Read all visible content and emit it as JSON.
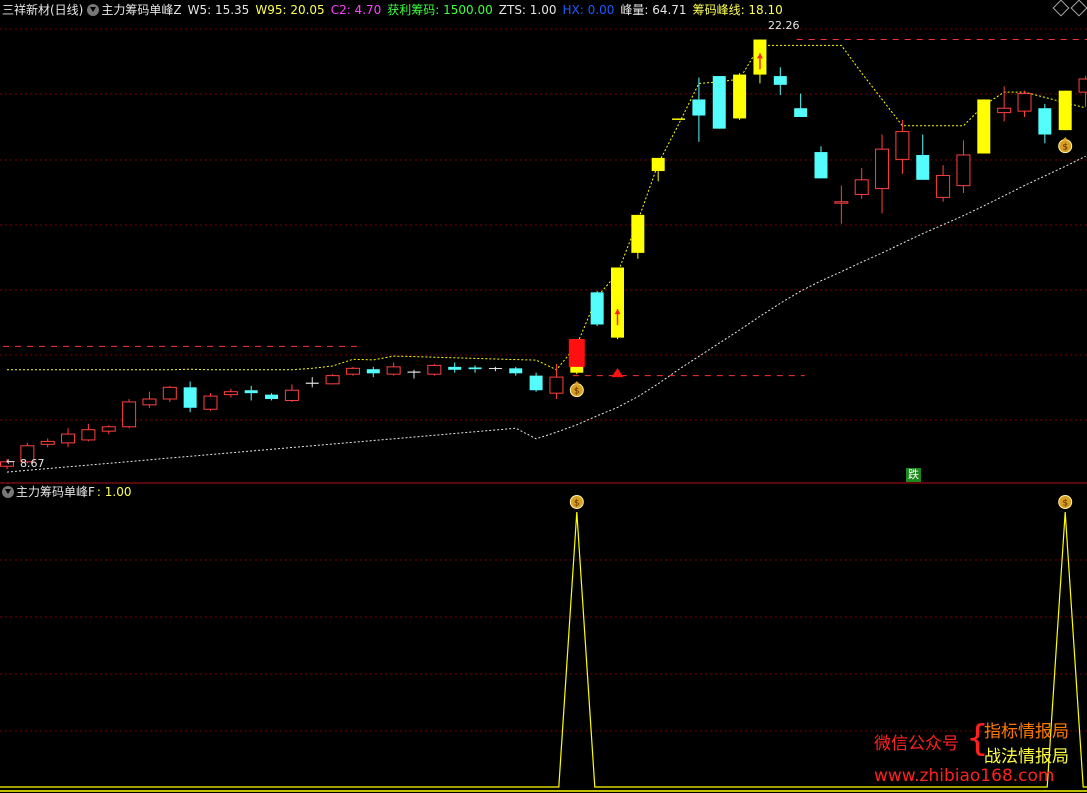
{
  "header": {
    "stock": "三祥新材(日线)",
    "indicator": "主力筹码单峰Z",
    "w5": "W5: 15.35",
    "w95": "W95: 20.05",
    "c2": "C2: 4.70",
    "profit": "获利筹码: 1500.00",
    "zts": "ZTS: 1.00",
    "hx": "HX: 0.00",
    "peak": "峰量: 64.71",
    "peakline": "筹码峰线: 18.10"
  },
  "sub_header": {
    "indicator": "主力筹码单峰F",
    "value": ": 1.00"
  },
  "labels": {
    "high_price": "22.26",
    "low_price": "8.67",
    "fall_tag": "跌",
    "money_glyph": "$"
  },
  "watermark": {
    "wechat": "微信公众号",
    "name1": "指标情报局",
    "name2": "战法情报局",
    "url": "www.zhibiao168.com"
  },
  "colors": {
    "bull": "#ff4040",
    "bear": "#54fcfc",
    "signal": "#ffff00",
    "grid": "#7a0000",
    "purple": "#ff40ff",
    "blue": "#1e5aff",
    "green": "#40ff40"
  },
  "chart_data": {
    "type": "candlestick",
    "candles": [
      {
        "o": 8.8,
        "c": 8.95,
        "h": 9.05,
        "l": 8.7,
        "t": "up"
      },
      {
        "o": 8.95,
        "c": 9.5,
        "h": 9.6,
        "l": 8.9,
        "t": "up"
      },
      {
        "o": 9.55,
        "c": 9.65,
        "h": 9.75,
        "l": 9.45,
        "t": "up"
      },
      {
        "o": 9.6,
        "c": 9.9,
        "h": 10.1,
        "l": 9.45,
        "t": "up"
      },
      {
        "o": 9.7,
        "c": 10.05,
        "h": 10.25,
        "l": 9.65,
        "t": "up"
      },
      {
        "o": 10.0,
        "c": 10.15,
        "h": 10.2,
        "l": 9.9,
        "t": "up"
      },
      {
        "o": 10.15,
        "c": 11.0,
        "h": 11.1,
        "l": 10.1,
        "t": "up"
      },
      {
        "o": 10.9,
        "c": 11.1,
        "h": 11.35,
        "l": 10.8,
        "t": "up"
      },
      {
        "o": 11.1,
        "c": 11.5,
        "h": 11.55,
        "l": 11.0,
        "t": "up"
      },
      {
        "o": 11.5,
        "c": 10.8,
        "h": 11.7,
        "l": 10.65,
        "t": "down"
      },
      {
        "o": 10.75,
        "c": 11.2,
        "h": 11.3,
        "l": 10.7,
        "t": "up"
      },
      {
        "o": 11.25,
        "c": 11.35,
        "h": 11.45,
        "l": 11.15,
        "t": "up"
      },
      {
        "o": 11.4,
        "c": 11.3,
        "h": 11.55,
        "l": 11.05,
        "t": "down"
      },
      {
        "o": 11.25,
        "c": 11.1,
        "h": 11.3,
        "l": 11.05,
        "t": "down"
      },
      {
        "o": 11.05,
        "c": 11.4,
        "h": 11.6,
        "l": 11.0,
        "t": "up"
      },
      {
        "o": 11.62,
        "c": 11.66,
        "h": 11.85,
        "l": 11.5,
        "t": "flat"
      },
      {
        "o": 11.62,
        "c": 11.9,
        "h": 11.95,
        "l": 11.6,
        "t": "up"
      },
      {
        "o": 11.95,
        "c": 12.15,
        "h": 12.2,
        "l": 11.9,
        "t": "up"
      },
      {
        "o": 12.12,
        "c": 11.98,
        "h": 12.2,
        "l": 11.85,
        "t": "down"
      },
      {
        "o": 11.95,
        "c": 12.2,
        "h": 12.35,
        "l": 11.9,
        "t": "up"
      },
      {
        "o": 12.0,
        "c": 12.04,
        "h": 12.1,
        "l": 11.8,
        "t": "flat"
      },
      {
        "o": 11.95,
        "c": 12.25,
        "h": 12.3,
        "l": 11.9,
        "t": "up"
      },
      {
        "o": 12.2,
        "c": 12.1,
        "h": 12.35,
        "l": 12.0,
        "t": "down"
      },
      {
        "o": 12.18,
        "c": 12.12,
        "h": 12.25,
        "l": 12.0,
        "t": "down"
      },
      {
        "o": 12.14,
        "c": 12.16,
        "h": 12.2,
        "l": 12.05,
        "t": "flat"
      },
      {
        "o": 12.15,
        "c": 11.98,
        "h": 12.2,
        "l": 11.9,
        "t": "down"
      },
      {
        "o": 11.9,
        "c": 11.4,
        "h": 12.0,
        "l": 11.35,
        "t": "down"
      },
      {
        "o": 11.3,
        "c": 11.85,
        "h": 12.3,
        "l": 11.1,
        "t": "up"
      },
      {
        "o": 12.0,
        "c": 13.15,
        "h": 13.15,
        "l": 11.95,
        "t": "signal"
      },
      {
        "o": 13.65,
        "c": 14.75,
        "h": 14.8,
        "l": 13.6,
        "t": "down"
      },
      {
        "o": 13.2,
        "c": 15.6,
        "h": 15.6,
        "l": 13.15,
        "t": "signal"
      },
      {
        "o": 16.1,
        "c": 17.4,
        "h": 17.4,
        "l": 15.9,
        "t": "signal"
      },
      {
        "o": 18.9,
        "c": 19.35,
        "h": 19.35,
        "l": 18.55,
        "t": "signal"
      },
      {
        "o": 20.65,
        "c": 20.7,
        "h": 20.7,
        "l": 20.65,
        "t": "signal"
      },
      {
        "o": 20.8,
        "c": 21.35,
        "h": 22.1,
        "l": 19.9,
        "t": "down"
      },
      {
        "o": 20.35,
        "c": 22.15,
        "h": 22.15,
        "l": 20.35,
        "t": "down"
      },
      {
        "o": 20.7,
        "c": 22.2,
        "h": 22.25,
        "l": 20.65,
        "t": "signal"
      },
      {
        "o": 22.2,
        "c": 23.4,
        "h": 23.4,
        "l": 21.9,
        "t": "signal"
      },
      {
        "o": 21.85,
        "c": 22.15,
        "h": 22.45,
        "l": 21.5,
        "t": "down"
      },
      {
        "o": 20.75,
        "c": 21.05,
        "h": 21.55,
        "l": 20.75,
        "t": "down"
      },
      {
        "o": 18.65,
        "c": 19.55,
        "h": 19.75,
        "l": 18.65,
        "t": "down"
      },
      {
        "o": 17.8,
        "c": 17.85,
        "h": 18.4,
        "l": 17.1,
        "t": "up"
      },
      {
        "o": 18.1,
        "c": 18.6,
        "h": 19.0,
        "l": 17.95,
        "t": "up"
      },
      {
        "o": 18.3,
        "c": 19.65,
        "h": 20.15,
        "l": 17.45,
        "t": "up"
      },
      {
        "o": 19.3,
        "c": 20.25,
        "h": 20.65,
        "l": 18.8,
        "t": "up"
      },
      {
        "o": 18.6,
        "c": 19.45,
        "h": 20.15,
        "l": 18.6,
        "t": "down"
      },
      {
        "o": 18.0,
        "c": 18.75,
        "h": 19.1,
        "l": 17.85,
        "t": "up"
      },
      {
        "o": 18.4,
        "c": 19.45,
        "h": 19.95,
        "l": 18.15,
        "t": "up"
      },
      {
        "o": 19.5,
        "c": 21.35,
        "h": 21.35,
        "l": 19.5,
        "t": "signal"
      },
      {
        "o": 20.9,
        "c": 21.05,
        "h": 21.8,
        "l": 20.6,
        "t": "up"
      },
      {
        "o": 20.95,
        "c": 21.55,
        "h": 21.65,
        "l": 20.75,
        "t": "up"
      },
      {
        "o": 20.15,
        "c": 21.05,
        "h": 21.2,
        "l": 19.85,
        "t": "down"
      },
      {
        "o": 20.3,
        "c": 21.65,
        "h": 21.65,
        "l": 20.3,
        "t": "signal"
      },
      {
        "o": 21.6,
        "c": 22.05,
        "h": 22.15,
        "l": 21.1,
        "t": "up"
      }
    ],
    "main_ylim": [
      8.5,
      24.0
    ],
    "sub_values": [
      0,
      0,
      0,
      0,
      0,
      0,
      0,
      0,
      0,
      0,
      0,
      0,
      0,
      0,
      0,
      0,
      0,
      0,
      0,
      0,
      0,
      0,
      0,
      0,
      0,
      0,
      0,
      0,
      1,
      0,
      0,
      0,
      0,
      0,
      0,
      0,
      0,
      0,
      0,
      0,
      0,
      0,
      0,
      0,
      0,
      0,
      0,
      0,
      0,
      0,
      0,
      0,
      1,
      0
    ],
    "sub_ylim": [
      0,
      1
    ],
    "ref_lines": [
      {
        "name": "W95 pre-breakout",
        "value": 12.9,
        "from": 0,
        "to": 17
      },
      {
        "name": "peak-line",
        "value": 11.9,
        "from": 28,
        "to": 39
      },
      {
        "name": "high",
        "value": 23.4,
        "from": 39,
        "to": 53
      }
    ],
    "price_markers": [
      "22.26",
      "8.67"
    ]
  }
}
